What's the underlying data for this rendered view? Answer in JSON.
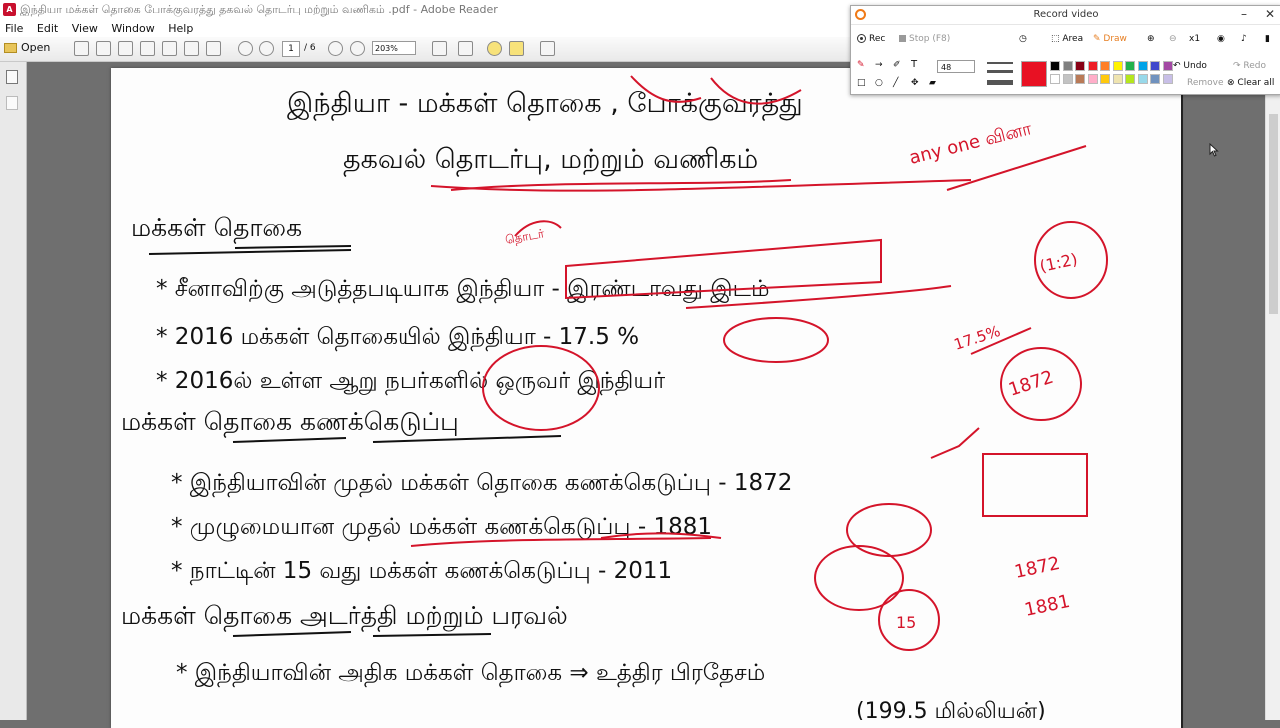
{
  "window": {
    "title": "இந்தியா மக்கள் தொகை போக்குவரத்து தகவல் தொடர்பு மற்றும் வணிகம் .pdf - Adobe Reader"
  },
  "menu": {
    "items": [
      "File",
      "Edit",
      "View",
      "Window",
      "Help"
    ]
  },
  "toolbar": {
    "open_label": "Open",
    "page_current": "1",
    "page_total": "/ 6",
    "zoom_value": "203%"
  },
  "recorder": {
    "title": "Record video",
    "rec_label": "Rec",
    "stop_label": "Stop (F8)",
    "area_label": "Area",
    "draw_label": "Draw",
    "zoom_factor": "x1",
    "size_value": "48",
    "undo_label": "Undo",
    "redo_label": "Redo",
    "remove_label": "Remove",
    "clear_all_label": "Clear all",
    "active_color": "#e81123",
    "palette": [
      "#000000",
      "#7f7f7f",
      "#880015",
      "#ed1c24",
      "#ff7f27",
      "#fff200",
      "#22b14c",
      "#00a2e8",
      "#3f48cc",
      "#a349a4",
      "#ffffff",
      "#c3c3c3",
      "#b97a57",
      "#ffaec9",
      "#ffc90e",
      "#efe4b0",
      "#b5e61d",
      "#99d9ea",
      "#7092be",
      "#c8bfe7"
    ]
  },
  "document": {
    "annotations": {
      "top_right_note": "any one வினா",
      "arrow_mark": "(1:2)",
      "percent_note": "17.5%",
      "circled_1872": "1872",
      "circled_15": "15",
      "year_note_1": "1872",
      "year_note_2": "1881",
      "small_note": "தொடர்"
    },
    "lines": {
      "l1": "இந்தியா - மக்கள் தொகை , போக்குவரத்து",
      "l2": "தகவல் தொடர்பு, மற்றும் வணிகம்",
      "h1": "மக்கள் தொகை",
      "b1": "* சீனாவிற்கு அடுத்தபடியாக இந்தியா - இரண்டாவது இடம்",
      "b2": "* 2016 மக்கள் தொகையில் இந்தியா - 17.5 %",
      "b3": "* 2016ல் உள்ள ஆறு நபர்களில் ஒருவர் இந்தியர்",
      "h2": "மக்கள் தொகை கணக்கெடுப்பு",
      "b4": "* இந்தியாவின் முதல் மக்கள் தொகை கணக்கெடுப்பு - 1872",
      "b5": "* முழுமையான முதல் மக்கள் கணக்கெடுப்பு - 1881",
      "b6": "* நாட்டின் 15 வது மக்கள் கணக்கெடுப்பு - 2011",
      "h3": "மக்கள் தொகை அடர்த்தி மற்றும் பரவல்",
      "b7": "* இந்தியாவின் அதிக மக்கள் தொகை ⇒ உத்திர பிரதேசம்",
      "b8": "(199.5 மில்லியன்)"
    }
  }
}
